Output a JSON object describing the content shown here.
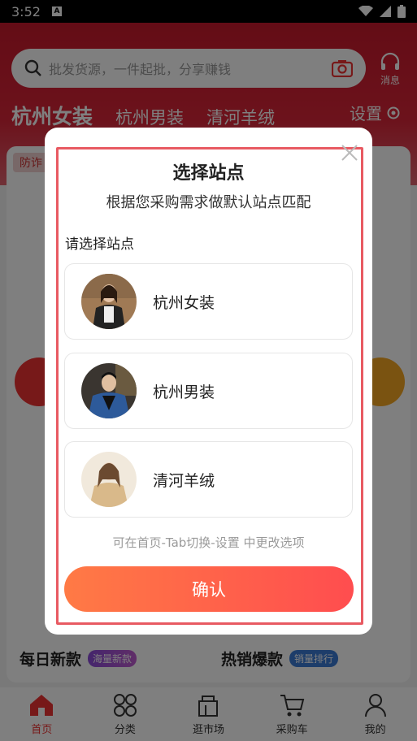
{
  "status_bar": {
    "time": "3:52"
  },
  "search": {
    "placeholder": "批发货源，一件起批，分享赚钱"
  },
  "header": {
    "message_label": "消息",
    "tabs": [
      "杭州女装",
      "杭州男装",
      "清河羊绒"
    ],
    "settings_label": "设置"
  },
  "background": {
    "promo_badge": "防诈",
    "section_left_title": "每日新款",
    "section_left_tag": "海量新款",
    "section_right_title": "热销爆款",
    "section_right_tag": "销量排行"
  },
  "bottom_nav": [
    {
      "label": "首页",
      "icon": "home-icon",
      "active": true
    },
    {
      "label": "分类",
      "icon": "category-icon",
      "active": false
    },
    {
      "label": "逛市场",
      "icon": "market-icon",
      "active": false
    },
    {
      "label": "采购车",
      "icon": "cart-icon",
      "active": false
    },
    {
      "label": "我的",
      "icon": "profile-icon",
      "active": false
    }
  ],
  "modal": {
    "title": "选择站点",
    "subtitle": "根据您采购需求做默认站点匹配",
    "choose_label": "请选择站点",
    "options": [
      {
        "name": "杭州女装"
      },
      {
        "name": "杭州男装"
      },
      {
        "name": "清河羊绒"
      }
    ],
    "hint": "可在首页-Tab切换-设置 中更改选项",
    "confirm_label": "确认"
  },
  "colors": {
    "brand_red": "#d92538",
    "confirm_start": "#ff7a45",
    "confirm_end": "#ff4d4f",
    "highlight_border": "#e85a62"
  }
}
